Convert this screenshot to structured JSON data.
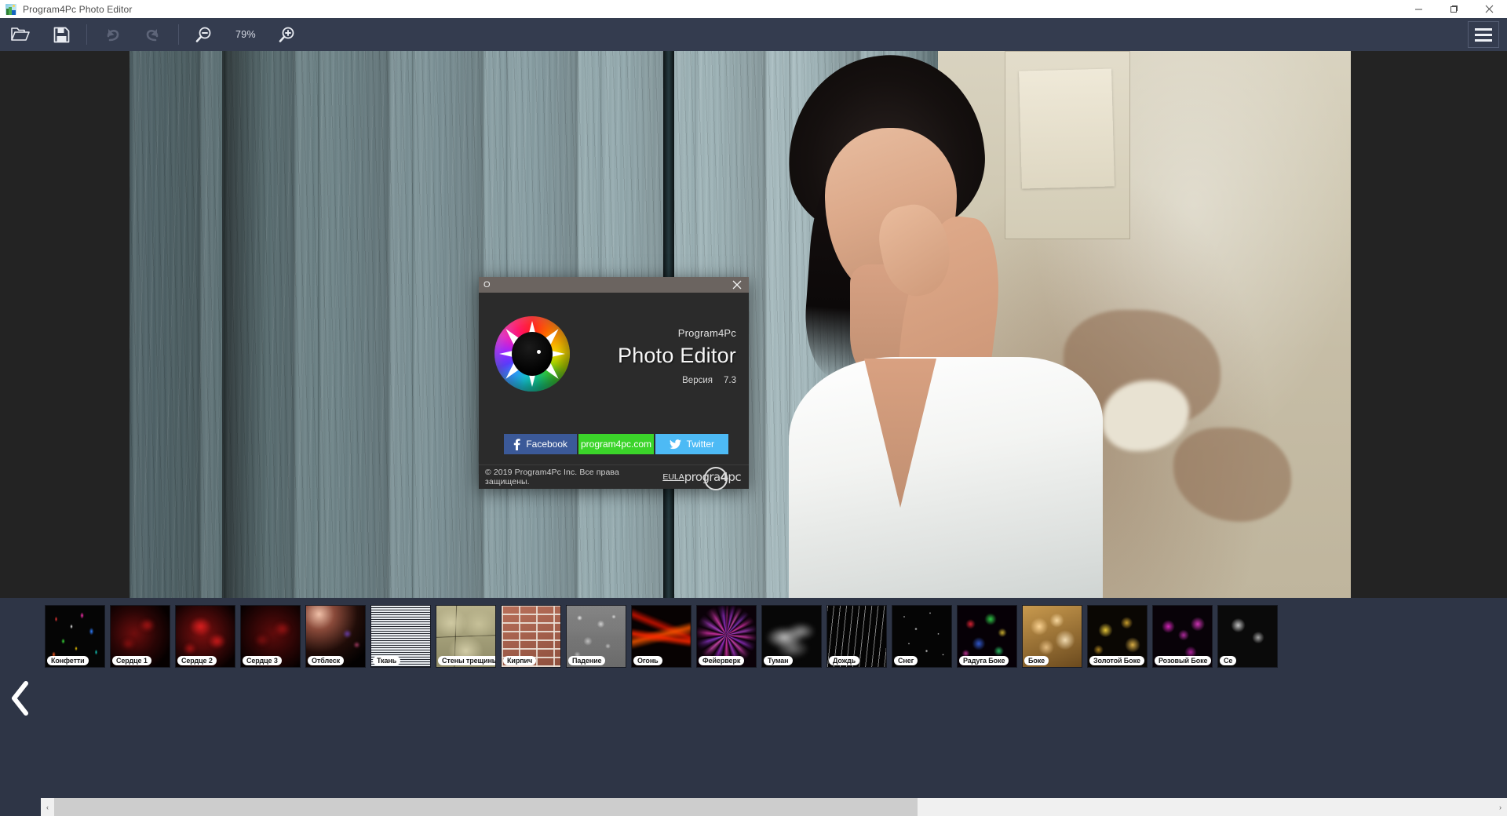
{
  "window": {
    "title": "Program4Pc Photo Editor",
    "app_icon": "photo-app-icon",
    "minimize_label": "Minimize",
    "maximize_label": "Maximize",
    "close_label": "Close"
  },
  "toolbar": {
    "open_label": "Open",
    "open_icon": "folder-open-icon",
    "save_label": "Save",
    "save_icon": "floppy-save-icon",
    "undo_label": "Undo",
    "undo_icon": "undo-arrow-icon",
    "redo_label": "Redo",
    "redo_icon": "redo-arrow-icon",
    "zoom_out_label": "Zoom Out",
    "zoom_out_icon": "magnifier-minus-icon",
    "zoom_in_label": "Zoom In",
    "zoom_in_icon": "magnifier-plus-icon",
    "zoom_level": "79%",
    "menu_label": "Menu",
    "menu_icon": "hamburger-menu-icon"
  },
  "dialog": {
    "title": "О",
    "close_icon": "close-x-icon",
    "logo_icon": "color-wheel-eye-logo",
    "brand_small": "Program4Pc",
    "brand_big": "Photo Editor",
    "version_label": "Версия",
    "version_value": "7.3",
    "buttons": [
      {
        "id": "facebook",
        "label": "Facebook",
        "icon": "facebook-icon",
        "color": "#3b5998"
      },
      {
        "id": "website",
        "label": "program4pc.com",
        "icon": "none",
        "color": "#3bd42a"
      },
      {
        "id": "twitter",
        "label": "Twitter",
        "icon": "twitter-bird-icon",
        "color": "#4dbaf5"
      }
    ],
    "copyright": "© 2019 Program4Pc Inc. Все права защищены.",
    "eula_label": "EULA",
    "footer_logo_pre": "progra",
    "footer_logo_num": "4",
    "footer_logo_post": "pc"
  },
  "filmstrip": {
    "prev_label": "Previous",
    "prev_icon": "chevron-left-icon",
    "items": [
      {
        "label": "Конфетти",
        "art": "a-confetti"
      },
      {
        "label": "Сердце 1",
        "art": "a-heart1"
      },
      {
        "label": "Сердце 2",
        "art": "a-heart2"
      },
      {
        "label": "Сердце 3",
        "art": "a-heart3"
      },
      {
        "label": "Отблеск",
        "art": "a-flare"
      },
      {
        "label": "Ткань",
        "art": "a-fabric"
      },
      {
        "label": "Стены трещины",
        "art": "a-wall"
      },
      {
        "label": "Кирпич",
        "art": "a-brick"
      },
      {
        "label": "Падение",
        "art": "a-drops"
      },
      {
        "label": "Огонь",
        "art": "a-fire"
      },
      {
        "label": "Фейерверк",
        "art": "a-fw"
      },
      {
        "label": "Туман",
        "art": "a-fog"
      },
      {
        "label": "Дождь",
        "art": "a-rain"
      },
      {
        "label": "Снег",
        "art": "a-snow"
      },
      {
        "label": "Радуга Боке",
        "art": "a-rbokeh"
      },
      {
        "label": "Боке",
        "art": "a-bokeh"
      },
      {
        "label": "Золотой Боке",
        "art": "a-gbokeh"
      },
      {
        "label": "Розовый Боке",
        "art": "a-pbokeh"
      },
      {
        "label": "Се",
        "art": "a-sbokeh"
      }
    ]
  },
  "scrollbar": {
    "left_arrow": "‹",
    "right_arrow": "›",
    "thumb_percent": 60
  },
  "colors": {
    "toolbar_bg": "#343c4f",
    "filmstrip_bg": "#2e3546",
    "canvas_bg": "#232323",
    "dialog_bg": "#2b2b2b",
    "dialog_title_bg": "#6b6460",
    "facebook_blue": "#3b5998",
    "site_green": "#3bd42a",
    "twitter_blue": "#4dbaf5"
  }
}
